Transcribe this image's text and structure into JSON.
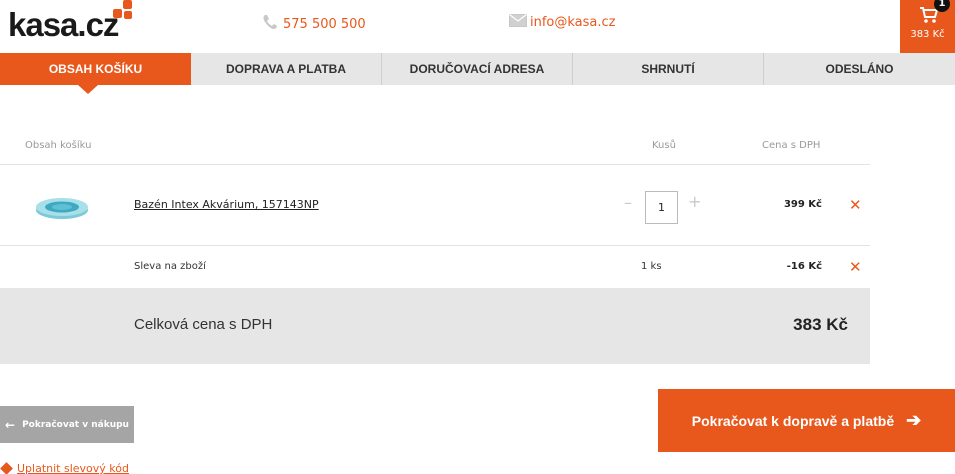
{
  "header": {
    "logo": "kasa.cz",
    "phone": "575 500 500",
    "email": "info@kasa.cz",
    "cart": {
      "count": "1",
      "total": "383 Kč"
    }
  },
  "steps": [
    {
      "label": "OBSAH KOŠÍKU",
      "active": true
    },
    {
      "label": "DOPRAVA A PLATBA",
      "active": false
    },
    {
      "label": "DORUČOVACÍ ADRESA",
      "active": false
    },
    {
      "label": "SHRNUTÍ",
      "active": false
    },
    {
      "label": "ODESLÁNO",
      "active": false
    }
  ],
  "table": {
    "col_items": "Obsah košíku",
    "col_qty": "Kusů",
    "col_price": "Cena s DPH"
  },
  "items": [
    {
      "name": "Bazén Intex Akvárium, 157143NP",
      "qty": "1",
      "price": "399 Kč"
    }
  ],
  "discount": {
    "label": "Sleva na zboží",
    "qty": "1 ks",
    "price": "-16 Kč"
  },
  "total": {
    "label": "Celková cena s DPH",
    "value": "383 Kč"
  },
  "buttons": {
    "back": "Pokračovat v nákupu",
    "next": "Pokračovat k dopravě a platbě"
  },
  "voucher": "Uplatnit slevový kód",
  "colors": {
    "accent": "#e8581c",
    "nav_bg": "#e6e6e6",
    "total_bg": "#e6e6e6",
    "back_button": "#a5a5a5"
  }
}
